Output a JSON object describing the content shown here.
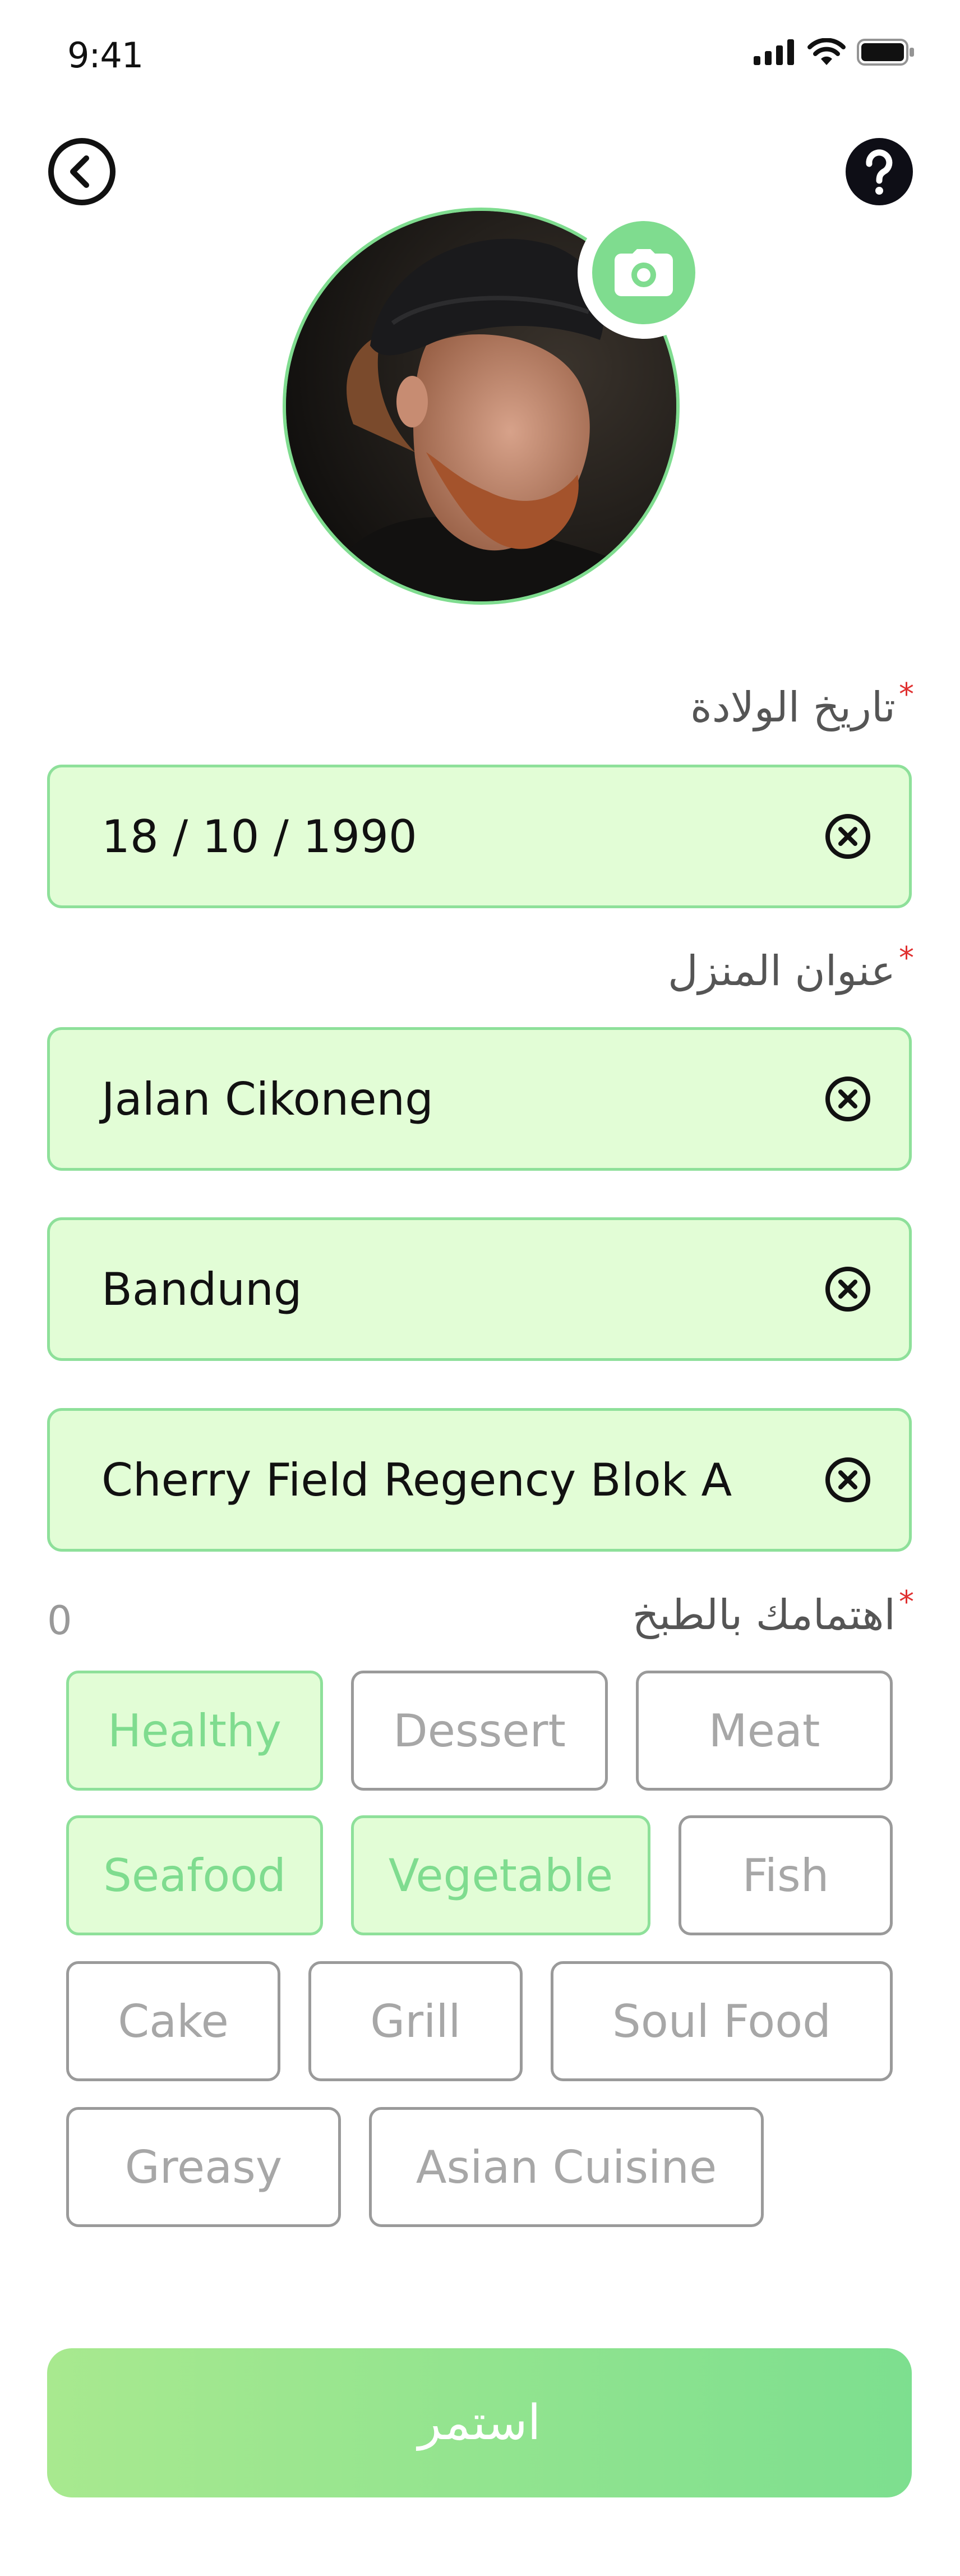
{
  "status_bar": {
    "time": "9:41"
  },
  "header": {
    "back_icon": "chevron-left-icon",
    "help_icon": "question-mark-icon"
  },
  "profile": {
    "camera_icon": "camera-icon"
  },
  "form": {
    "birth_date": {
      "label": "تاريخ الولادة",
      "required_mark": "*",
      "value": "18 / 10 / 1990"
    },
    "home_address": {
      "label": "عنوان المنزل",
      "required_mark": "*",
      "lines": [
        "Jalan Cikoneng",
        "Bandung",
        "Cherry Field Regency Blok A"
      ]
    },
    "cooking_interest": {
      "label": "اهتمامك بالطبخ",
      "required_mark": "*",
      "count": "0",
      "chips": [
        {
          "label": "Healthy",
          "selected": true
        },
        {
          "label": "Dessert",
          "selected": false
        },
        {
          "label": "Meat",
          "selected": false
        },
        {
          "label": "Seafood",
          "selected": true
        },
        {
          "label": "Vegetable",
          "selected": true
        },
        {
          "label": "Fish",
          "selected": false
        },
        {
          "label": "Cake",
          "selected": false
        },
        {
          "label": "Grill",
          "selected": false
        },
        {
          "label": "Soul Food",
          "selected": false
        },
        {
          "label": "Greasy",
          "selected": false
        },
        {
          "label": "Asian Cuisine",
          "selected": false
        }
      ]
    }
  },
  "continue_button": {
    "label": "استمر"
  },
  "colors": {
    "accent": "#7fdc8f",
    "field_bg": "#e2fdd6",
    "required": "#e03030",
    "chip_border": "#9a9a9a"
  }
}
